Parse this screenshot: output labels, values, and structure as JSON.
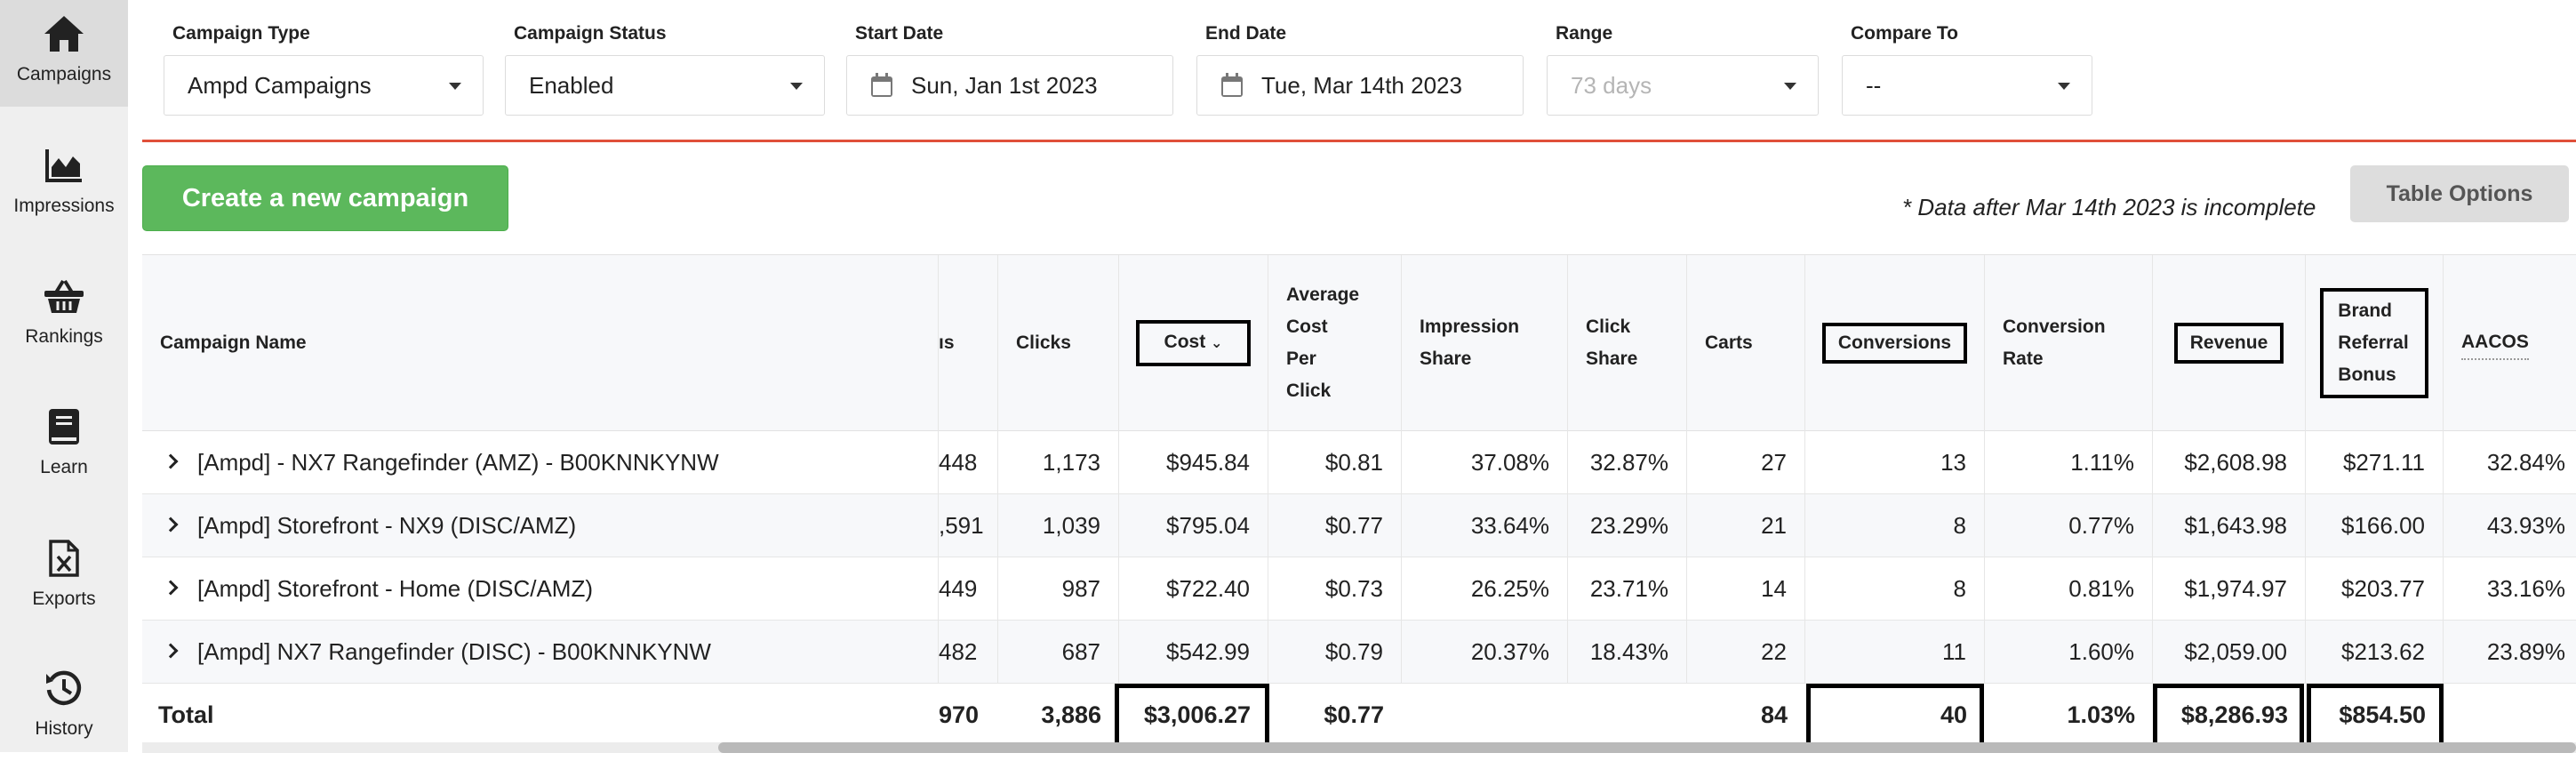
{
  "sidebar": {
    "items": [
      {
        "label": "Campaigns",
        "icon": "home-icon",
        "active": true
      },
      {
        "label": "Impressions",
        "icon": "area-chart-icon"
      },
      {
        "label": "Rankings",
        "icon": "basket-icon"
      },
      {
        "label": "Learn",
        "icon": "book-icon"
      },
      {
        "label": "Exports",
        "icon": "excel-file-icon"
      },
      {
        "label": "History",
        "icon": "history-icon"
      }
    ]
  },
  "filters": {
    "campaign_type": {
      "label": "Campaign Type",
      "value": "Ampd Campaigns"
    },
    "campaign_status": {
      "label": "Campaign Status",
      "value": "Enabled"
    },
    "start_date": {
      "label": "Start Date",
      "value": "Sun, Jan 1st 2023"
    },
    "end_date": {
      "label": "End Date",
      "value": "Tue, Mar 14th 2023"
    },
    "range": {
      "label": "Range",
      "value": "73 days"
    },
    "compare_to": {
      "label": "Compare To",
      "value": "--"
    }
  },
  "toolbar": {
    "create_label": "Create a new campaign",
    "note": "* Data after Mar 14th 2023 is incomplete",
    "table_options_label": "Table Options"
  },
  "table": {
    "headers": {
      "name": "Campaign Name",
      "impressions_partial": "ıs",
      "clicks": "Clicks",
      "cost": "Cost",
      "avg_cpc": [
        "Average",
        "Cost",
        "Per",
        "Click"
      ],
      "impression_share": [
        "Impression",
        "Share"
      ],
      "click_share": [
        "Click",
        "Share"
      ],
      "carts": "Carts",
      "conversions": "Conversions",
      "conversion_rate": [
        "Conversion",
        "Rate"
      ],
      "revenue": "Revenue",
      "brand_referral": [
        "Brand",
        "Referral",
        "Bonus"
      ],
      "aacos": "AACOS"
    },
    "rows": [
      {
        "name": "[Ampd] - NX7 Rangefinder (AMZ) - B00KNNKYNW",
        "impressions": "448",
        "clicks": "1,173",
        "cost": "$945.84",
        "avg_cpc": "$0.81",
        "impression_share": "37.08%",
        "click_share": "32.87%",
        "carts": "27",
        "conversions": "13",
        "conversion_rate": "1.11%",
        "revenue": "$2,608.98",
        "brand_referral": "$271.11",
        "aacos": "32.84%"
      },
      {
        "name": "[Ampd] Storefront - NX9 (DISC/AMZ)",
        "impressions": ",591",
        "clicks": "1,039",
        "cost": "$795.04",
        "avg_cpc": "$0.77",
        "impression_share": "33.64%",
        "click_share": "23.29%",
        "carts": "21",
        "conversions": "8",
        "conversion_rate": "0.77%",
        "revenue": "$1,643.98",
        "brand_referral": "$166.00",
        "aacos": "43.93%"
      },
      {
        "name": "[Ampd] Storefront - Home (DISC/AMZ)",
        "impressions": "449",
        "clicks": "987",
        "cost": "$722.40",
        "avg_cpc": "$0.73",
        "impression_share": "26.25%",
        "click_share": "23.71%",
        "carts": "14",
        "conversions": "8",
        "conversion_rate": "0.81%",
        "revenue": "$1,974.97",
        "brand_referral": "$203.77",
        "aacos": "33.16%"
      },
      {
        "name": "[Ampd] NX7 Rangefinder (DISC) - B00KNNKYNW",
        "impressions": "482",
        "clicks": "687",
        "cost": "$542.99",
        "avg_cpc": "$0.79",
        "impression_share": "20.37%",
        "click_share": "18.43%",
        "carts": "22",
        "conversions": "11",
        "conversion_rate": "1.60%",
        "revenue": "$2,059.00",
        "brand_referral": "$213.62",
        "aacos": "23.89%"
      }
    ],
    "total": {
      "label": "Total",
      "impressions": "970",
      "clicks": "3,886",
      "cost": "$3,006.27",
      "avg_cpc": "$0.77",
      "carts": "84",
      "conversions": "40",
      "conversion_rate": "1.03%",
      "revenue": "$8,286.93",
      "brand_referral": "$854.50"
    }
  }
}
